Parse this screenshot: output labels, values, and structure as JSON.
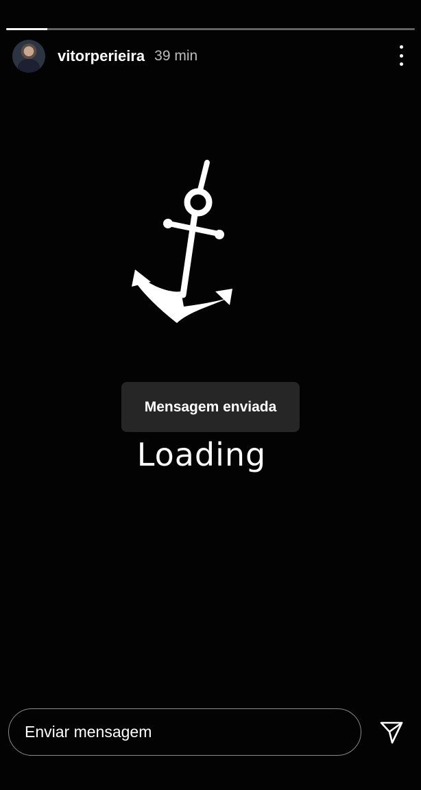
{
  "story": {
    "progress": 0.1,
    "username": "vitorperieira",
    "time": "39 min",
    "loading_text": "Loading"
  },
  "toast": {
    "message": "Mensagem enviada"
  },
  "reply": {
    "placeholder": "Enviar mensagem"
  },
  "icons": {
    "more": "more-vertical-icon",
    "send": "paper-plane-icon",
    "anchor": "anchor-icon"
  },
  "colors": {
    "background": "#030303",
    "toast_bg": "#262626",
    "text": "#ffffff"
  }
}
